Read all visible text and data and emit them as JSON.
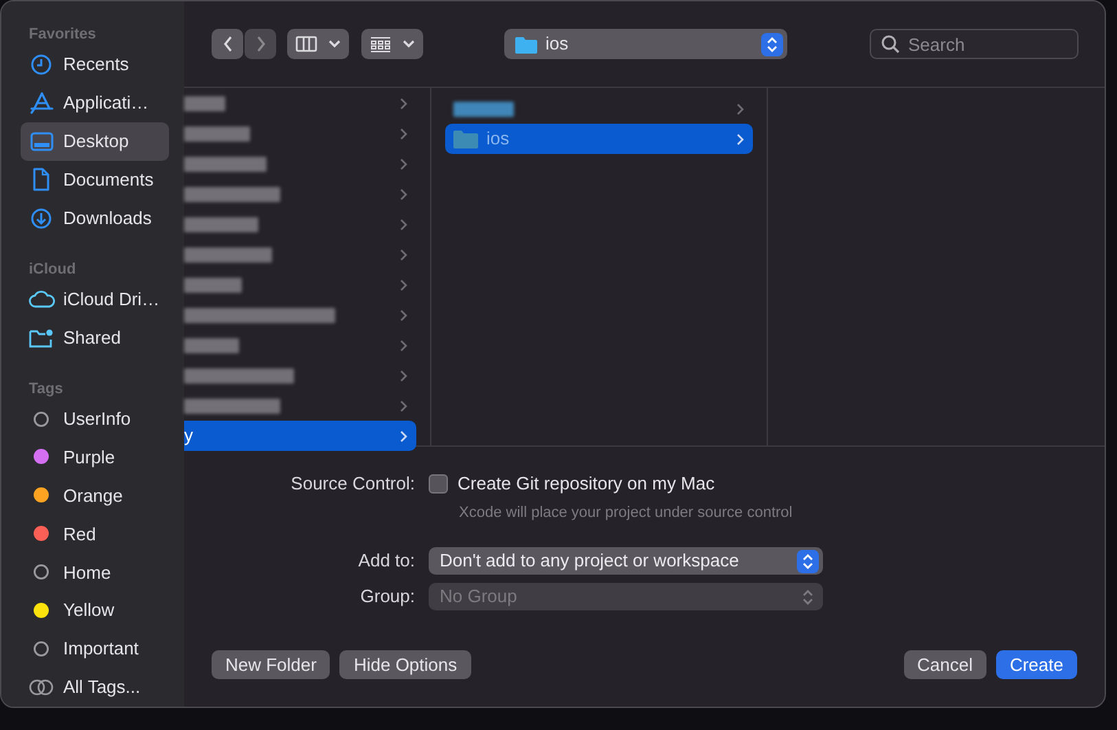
{
  "sidebar": {
    "sections": [
      {
        "title": "Favorites",
        "items": [
          {
            "label": "Recents",
            "kind": "recents",
            "selected": false
          },
          {
            "label": "Applicati…",
            "kind": "apps",
            "selected": false
          },
          {
            "label": "Desktop",
            "kind": "desktop",
            "selected": true
          },
          {
            "label": "Documents",
            "kind": "document",
            "selected": false
          },
          {
            "label": "Downloads",
            "kind": "download",
            "selected": false
          }
        ]
      },
      {
        "title": "iCloud",
        "items": [
          {
            "label": "iCloud Dri…",
            "kind": "cloud",
            "selected": false
          },
          {
            "label": "Shared",
            "kind": "shared",
            "selected": false
          }
        ]
      },
      {
        "title": "Tags",
        "items": [
          {
            "label": "UserInfo",
            "kind": "tag",
            "selected": false
          },
          {
            "label": "Purple",
            "kind": "tag",
            "color": "#d46ff2",
            "selected": false
          },
          {
            "label": "Orange",
            "kind": "tag",
            "color": "#fca322",
            "selected": false
          },
          {
            "label": "Red",
            "kind": "tag",
            "color": "#fb5f56",
            "selected": false
          },
          {
            "label": "Home",
            "kind": "tag",
            "selected": false
          },
          {
            "label": "Yellow",
            "kind": "tag",
            "color": "#fde20b",
            "selected": false
          },
          {
            "label": "Important",
            "kind": "tag",
            "selected": false
          },
          {
            "label": "All Tags...",
            "kind": "all-tags",
            "selected": false
          }
        ]
      }
    ]
  },
  "toolbar": {
    "back": {
      "disabled": false
    },
    "forward": {
      "disabled": true
    },
    "location": "ios",
    "search": {
      "placeholder": "Search"
    }
  },
  "columns": [
    {
      "rows": [
        {
          "kind": "blurred",
          "selected": false
        },
        {
          "kind": "blurred",
          "selected": false
        },
        {
          "kind": "blurred",
          "selected": false
        },
        {
          "kind": "blurred",
          "selected": false
        },
        {
          "kind": "blurred",
          "selected": false
        },
        {
          "kind": "blurred",
          "selected": false
        },
        {
          "kind": "blurred",
          "selected": false
        },
        {
          "kind": "blurred",
          "selected": false
        },
        {
          "kind": "blurred",
          "selected": false
        },
        {
          "kind": "blurred",
          "selected": false
        },
        {
          "kind": "blurred",
          "selected": false
        },
        {
          "kind": "folder",
          "label": "y",
          "selected": true
        }
      ]
    },
    {
      "rows": [
        {
          "kind": "blurred",
          "selected": false
        },
        {
          "kind": "folder",
          "label": "ios",
          "selected": true
        }
      ]
    },
    {}
  ],
  "options": {
    "source_control": {
      "label": "Source Control:",
      "checkbox": "Create Git repository on my Mac",
      "checked": false,
      "hint": "Xcode will place your project under source control"
    },
    "add_to": {
      "label": "Add to:",
      "value": "Don't add to any project or workspace",
      "disabled": false
    },
    "group": {
      "label": "Group:",
      "value": "No Group",
      "disabled": true
    }
  },
  "buttons": [
    {
      "label": "New Folder",
      "kind": "default"
    },
    {
      "label": "Hide Options",
      "kind": "default"
    },
    {
      "kind": "spacer"
    },
    {
      "label": "Cancel",
      "kind": "default"
    },
    {
      "label": "Create",
      "kind": "primary"
    }
  ]
}
